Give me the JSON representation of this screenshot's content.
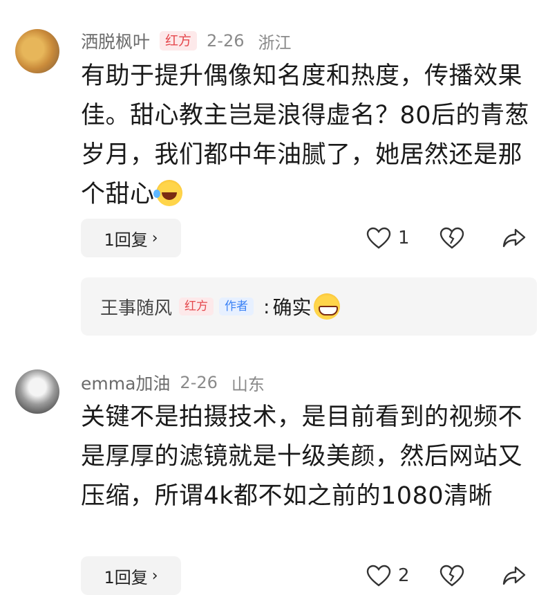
{
  "comments": [
    {
      "username": "洒脱枫叶",
      "badge": "红方",
      "date": "2-26",
      "location": "浙江",
      "text": "有助于提升偶像知名度和热度，传播效果佳。甜心教主岂是浪得虚名？80后的青葱岁月，我们都中年油腻了，她居然还是那个甜心",
      "emoji": "laughing-tears-emoji",
      "reply_button": "1回复",
      "like_count": "1",
      "sub_reply": {
        "username": "王事随风",
        "badge": "红方",
        "author_badge": "作者",
        "colon": ":",
        "text": "确实",
        "emoji": "grinning-emoji"
      }
    },
    {
      "username": "emma加油",
      "date": "2-26",
      "location": "山东",
      "text": "关键不是拍摄技术，是目前看到的视频不是厚厚的滤镜就是十级美颜，然后网站又压缩，所谓4k都不如之前的1080清晰",
      "reply_button": "1回复",
      "like_count": "2"
    }
  ],
  "colors": {
    "badge_red": "#e5484d",
    "badge_blue": "#3b82f6",
    "meta_gray": "#8a8a8a"
  },
  "icons": [
    "heart-icon",
    "broken-heart-icon",
    "share-icon",
    "chevron-right-icon"
  ]
}
